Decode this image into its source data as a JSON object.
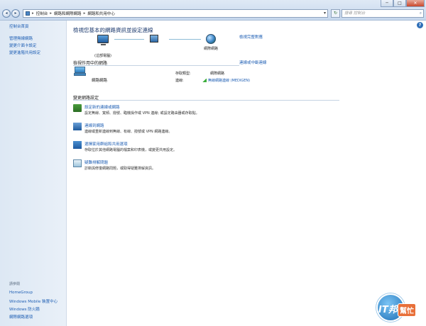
{
  "window": {
    "minimize": "─",
    "maximize": "□",
    "close": "✕"
  },
  "address": {
    "crumbs": [
      "控制台",
      "網路和網際網路",
      "網路和共用中心"
    ],
    "search_placeholder": "搜尋 控制台"
  },
  "sidebar": {
    "items": [
      "控制台首頁",
      "管理無線網路",
      "變更介面卡設定",
      "變更進階共用設定"
    ],
    "see_also_header": "請參閱",
    "see_also": [
      "HomeGroup",
      "Windows Mobile 裝置中心",
      "Windows 防火牆",
      "網際網路選項"
    ]
  },
  "main": {
    "title": "檢視您基本的網路資訊並設定連線",
    "full_map_link": "檢視完整對應",
    "map": {
      "computer_label": "(這部電腦)",
      "internet_label": "網際網路"
    },
    "active_networks": {
      "header": "檢視作用中的網路",
      "connect_link": "連線或中斷連線",
      "network_name": "網路網路",
      "access_type_label": "存取類型:",
      "access_type_value": "網際網路",
      "connections_label": "連線:",
      "connection_value": "無線網路連線 (MEDIGEN)"
    },
    "change_settings": {
      "header": "變更網路設定",
      "tasks": [
        {
          "title": "設定新的連線或網路",
          "desc": "設定無線、寬頻、撥號、臨機操作或 VPN 連線; 或設定路由器或存取點。"
        },
        {
          "title": "連線到網路",
          "desc": "連線或重新連線到無線、有線、撥號或 VPN 網路連線。"
        },
        {
          "title": "選擇家用群組和共用選項",
          "desc": "存取位於其他網路電腦的檔案和印表機，或變更共用設定。"
        },
        {
          "title": "疑難排解問題",
          "desc": "診斷與修復網路問題，或取得疑難排解資訊。"
        }
      ]
    }
  },
  "watermark": {
    "text1": "IT邦",
    "text2": "幫忙"
  },
  "colors": {
    "link": "#1f5fb4",
    "title": "#1c3a6e",
    "sidebar_bg": "#dde8f4"
  }
}
